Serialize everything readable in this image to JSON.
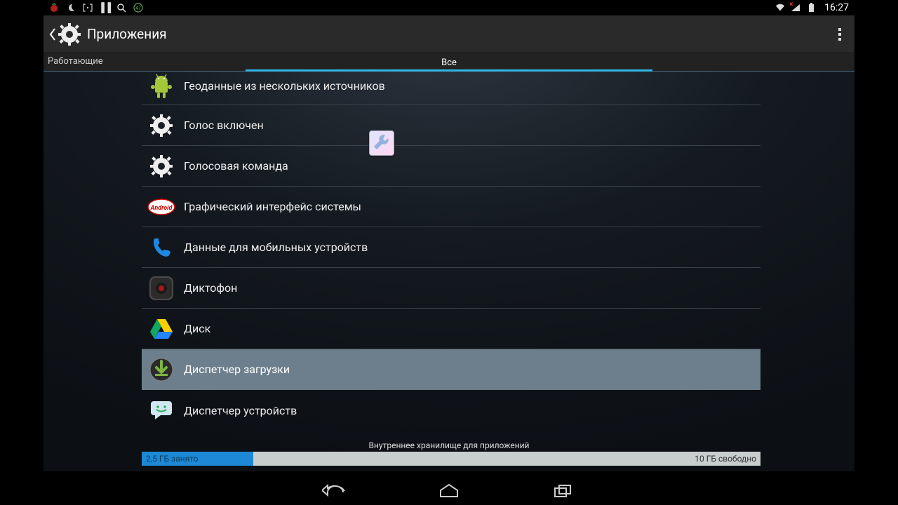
{
  "statusbar": {
    "time": "16:27"
  },
  "actionbar": {
    "title": "Приложения"
  },
  "tabs": [
    {
      "label": "Работающие",
      "active": false
    },
    {
      "label": "Все",
      "active": true
    }
  ],
  "apps": [
    {
      "name": "Геоданные из нескольких источников",
      "icon": "android-robot",
      "selected": false
    },
    {
      "name": "Голос включен",
      "icon": "gear",
      "selected": false
    },
    {
      "name": "Голосовая команда",
      "icon": "gear",
      "selected": false
    },
    {
      "name": "Графический интерфейс системы",
      "icon": "android-kitkat",
      "selected": false
    },
    {
      "name": "Данные для мобильных устройств",
      "icon": "phone",
      "selected": false
    },
    {
      "name": "Диктофон",
      "icon": "recorder",
      "selected": false
    },
    {
      "name": "Диск",
      "icon": "google-drive",
      "selected": false
    },
    {
      "name": "Диспетчер загрузки",
      "icon": "download",
      "selected": true
    },
    {
      "name": "Диспетчер устройств",
      "icon": "chat-smile",
      "selected": false
    }
  ],
  "storage": {
    "title": "Внутреннее хранилище для приложений",
    "used_label": "2,5 ГБ занято",
    "free_label": "10 ГБ свободно",
    "used_fraction": 0.18
  }
}
